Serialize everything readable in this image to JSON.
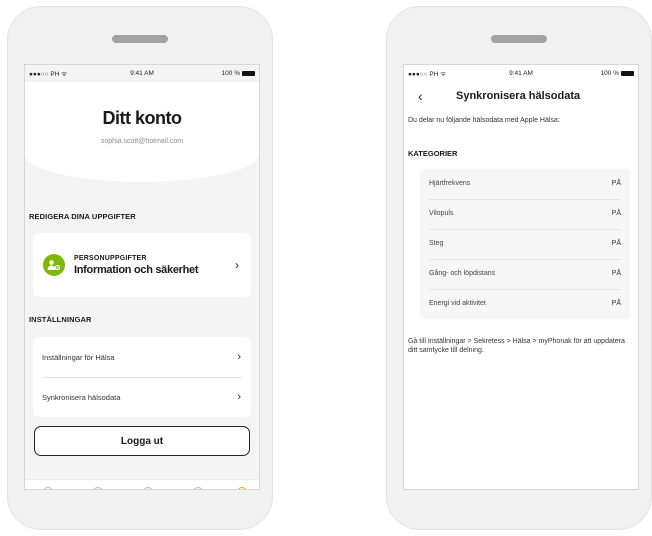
{
  "left": {
    "status": {
      "carrier": "●●●○○ PH ᯤ",
      "time": "9:41 AM",
      "battery": "100 %"
    },
    "header": {
      "title": "Ditt konto",
      "email": "sophia.scott@hotmail.com"
    },
    "edit_section": {
      "heading": "REDIGERA DINA UPPGIFTER",
      "card": {
        "label": "PERSONUPPGIFTER",
        "title": "Information och säkerhet"
      }
    },
    "settings_section": {
      "heading": "INSTÄLLNINGAR",
      "items": [
        {
          "label": "Inställningar för Hälsa"
        },
        {
          "label": "Synkronisera hälsodata"
        }
      ]
    },
    "logout_label": "Logga ut"
  },
  "right": {
    "status": {
      "carrier": "●●●○○ PH ᯤ",
      "time": "9:41 AM",
      "battery": "100 %"
    },
    "title": "Synkronisera hälsodata",
    "intro": "Du delar nu följande hälsodata med Apple Hälsa:",
    "categories_heading": "KATEGORIER",
    "categories": [
      {
        "label": "Hjärtfrekvens",
        "value": "PÅ"
      },
      {
        "label": "Vilopuls",
        "value": "PÅ"
      },
      {
        "label": "Steg",
        "value": "PÅ"
      },
      {
        "label": "Gång- och löpdistans",
        "value": "PÅ"
      },
      {
        "label": "Energi vid aktivitet",
        "value": "PÅ"
      }
    ],
    "footer": "Gå till Inställningar > Sekretess > Hälsa > myPhonak för att uppdatera ditt samtycke till delning."
  },
  "colors": {
    "accent": "#7fb800"
  }
}
